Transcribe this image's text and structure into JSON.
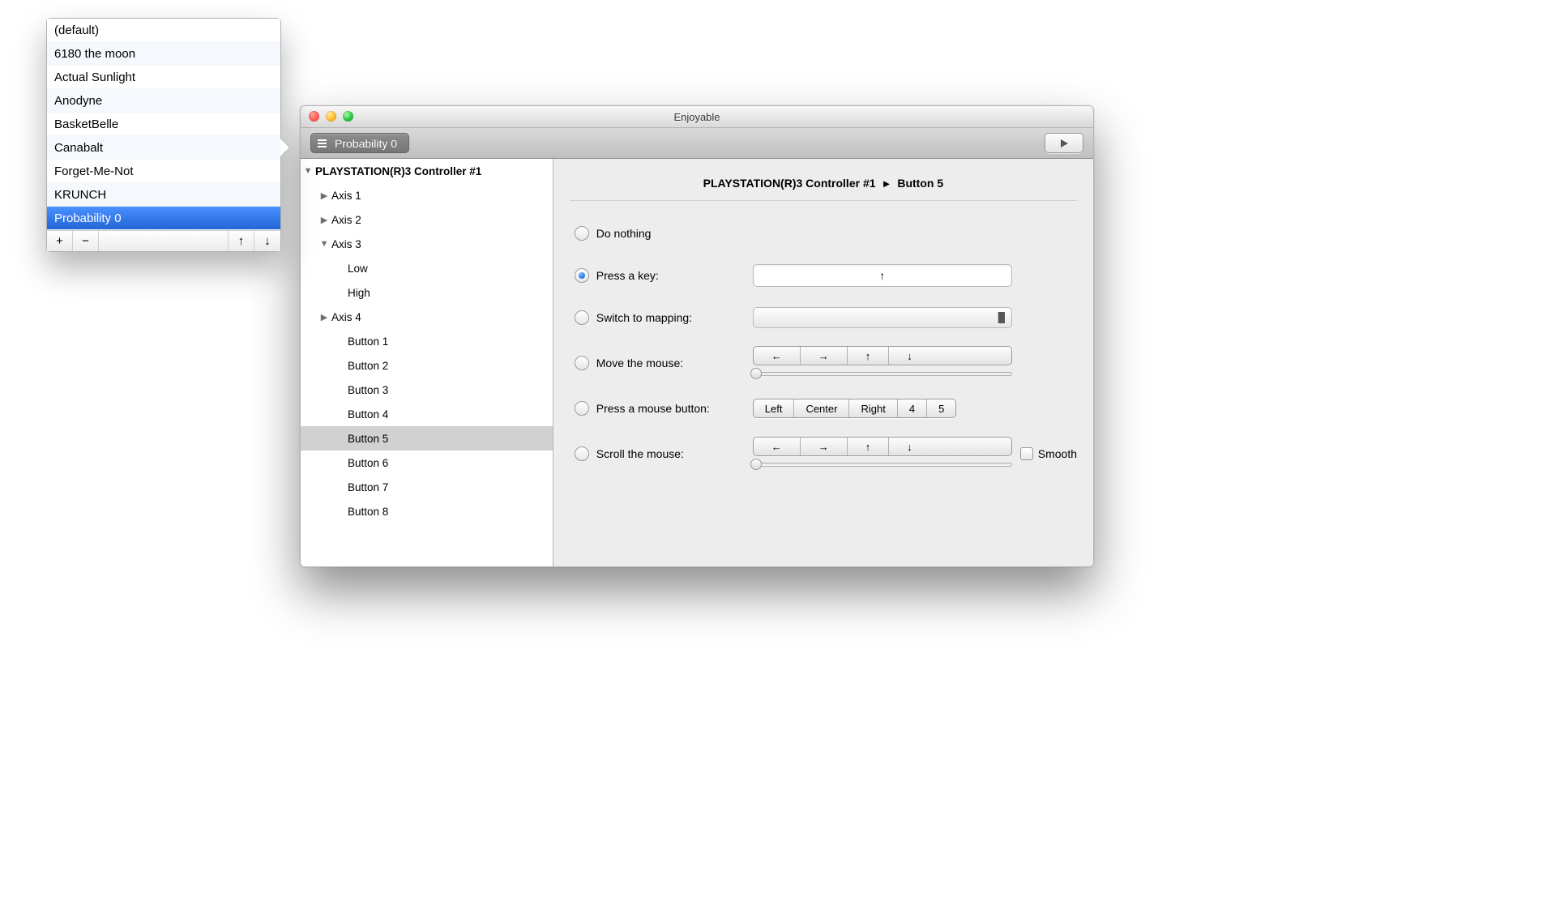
{
  "window": {
    "title": "Enjoyable"
  },
  "toolbar": {
    "current_mapping": "Probability 0"
  },
  "popover": {
    "items": [
      {
        "label": "(default)",
        "selected": false
      },
      {
        "label": "6180 the moon",
        "selected": false
      },
      {
        "label": "Actual Sunlight",
        "selected": false
      },
      {
        "label": "Anodyne",
        "selected": false
      },
      {
        "label": "BasketBelle",
        "selected": false
      },
      {
        "label": "Canabalt",
        "selected": false
      },
      {
        "label": "Forget-Me-Not",
        "selected": false
      },
      {
        "label": "KRUNCH",
        "selected": false
      },
      {
        "label": "Probability 0",
        "selected": true
      }
    ]
  },
  "tree": {
    "device": "PLAYSTATION(R)3 Controller #1",
    "items": [
      {
        "label": "Axis 1",
        "depth": 1,
        "caret": "right"
      },
      {
        "label": "Axis 2",
        "depth": 1,
        "caret": "right"
      },
      {
        "label": "Axis 3",
        "depth": 1,
        "caret": "down"
      },
      {
        "label": "Low",
        "depth": 2
      },
      {
        "label": "High",
        "depth": 2
      },
      {
        "label": "Axis 4",
        "depth": 1,
        "caret": "right"
      },
      {
        "label": "Button 1",
        "depth": 2
      },
      {
        "label": "Button 2",
        "depth": 2
      },
      {
        "label": "Button 3",
        "depth": 2
      },
      {
        "label": "Button 4",
        "depth": 2
      },
      {
        "label": "Button 5",
        "depth": 2,
        "selected": true
      },
      {
        "label": "Button 6",
        "depth": 2
      },
      {
        "label": "Button 7",
        "depth": 2
      },
      {
        "label": "Button 8",
        "depth": 2
      }
    ]
  },
  "detail": {
    "heading_device": "PLAYSTATION(R)3 Controller #1",
    "heading_input": "Button 5",
    "options": {
      "do_nothing": "Do nothing",
      "press_key": "Press a key:",
      "switch_mapping": "Switch to mapping:",
      "move_mouse": "Move the mouse:",
      "press_mouse": "Press a mouse button:",
      "scroll_mouse": "Scroll the mouse:"
    },
    "key_field_value": "↑",
    "switch_mapping_value": "",
    "move_dirs": [
      "←",
      "→",
      "↑",
      "↓"
    ],
    "mouse_buttons": [
      "Left",
      "Center",
      "Right",
      "4",
      "5"
    ],
    "scroll_dirs": [
      "←",
      "→",
      "↑",
      "↓"
    ],
    "smooth_label": "Smooth",
    "selected": "press_key"
  }
}
